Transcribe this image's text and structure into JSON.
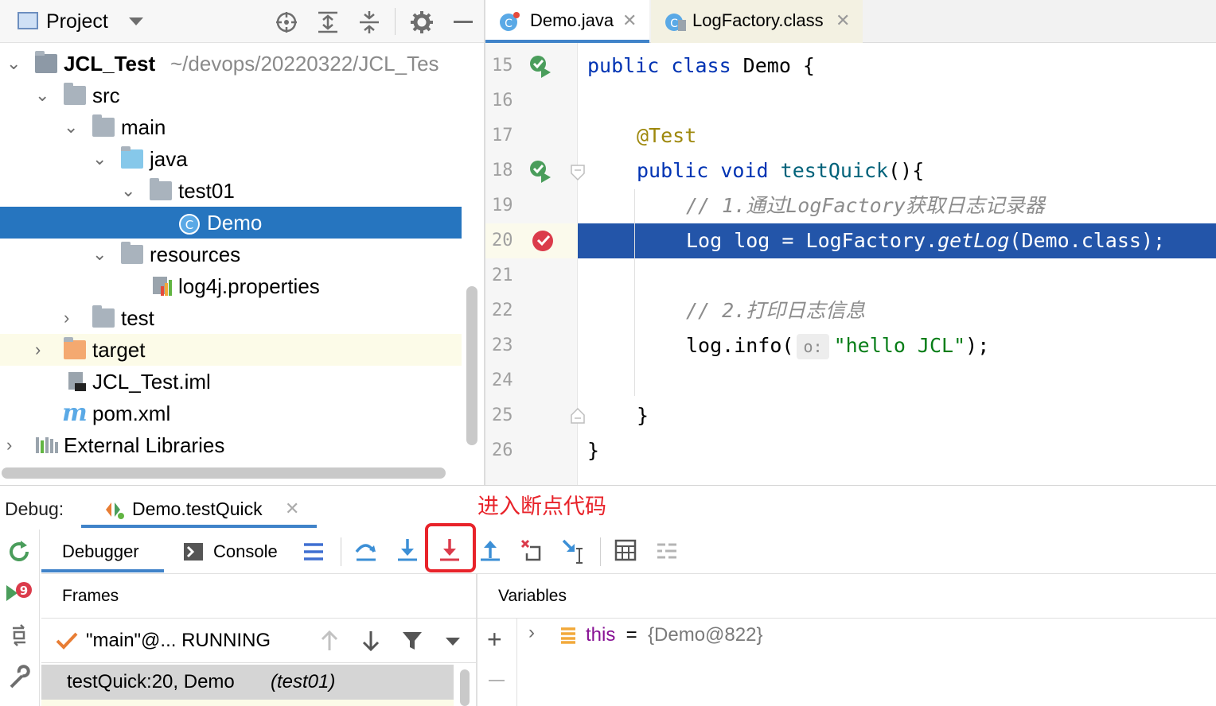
{
  "project_panel": {
    "title": "Project",
    "tree": [
      {
        "label": "JCL_Test",
        "path": "~/devops/20220322/JCL_Tes"
      },
      {
        "label": "src"
      },
      {
        "label": "main"
      },
      {
        "label": "java"
      },
      {
        "label": "test01"
      },
      {
        "label": "Demo"
      },
      {
        "label": "resources"
      },
      {
        "label": "log4j.properties"
      },
      {
        "label": "test"
      },
      {
        "label": "target"
      },
      {
        "label": "JCL_Test.iml"
      },
      {
        "label": "pom.xml"
      },
      {
        "label": "External Libraries"
      }
    ]
  },
  "editor": {
    "tabs": [
      {
        "label": "Demo.java"
      },
      {
        "label": "LogFactory.class"
      }
    ],
    "line_numbers": [
      "15",
      "16",
      "17",
      "18",
      "19",
      "20",
      "21",
      "22",
      "23",
      "24",
      "25",
      "26"
    ],
    "code": {
      "l15_kw": "public class",
      "l15_rest": " Demo {",
      "l17_ann": "@Test",
      "l18_kw": "public void",
      "l18_fn": "testQuick",
      "l18_rest": "(){",
      "l19_cmt": "// 1.通过LogFactory获取日志记录器",
      "l20_text": "Log log = LogFactory.",
      "l20_italic": "getLog",
      "l20_rest": "(Demo.class);",
      "l22_cmt": "// 2.打印日志信息",
      "l23_pre": "log.info(",
      "l23_hint": "o:",
      "l23_str": "\"hello JCL\"",
      "l23_post": ");",
      "l25": "}",
      "l26": "}"
    }
  },
  "debug": {
    "label": "Debug:",
    "session_tab": "Demo.testQuick",
    "annotation": "进入断点代码",
    "annotation_color": "#e8232a",
    "tabs": {
      "debugger": "Debugger",
      "console": "Console"
    },
    "frames_header": "Frames",
    "variables_header": "Variables",
    "thread": "\"main\"@... RUNNING",
    "frame_method": "testQuick:20, Demo ",
    "frame_pkg": "(test01)",
    "variable": {
      "name": "this",
      "eq": " = ",
      "value": "{Demo@822}"
    }
  },
  "colors": {
    "selection": "#2675bf",
    "execution_line": "#2355a9",
    "keyword": "#0033b3",
    "annotation": "#9e880d",
    "string": "#067d17"
  }
}
